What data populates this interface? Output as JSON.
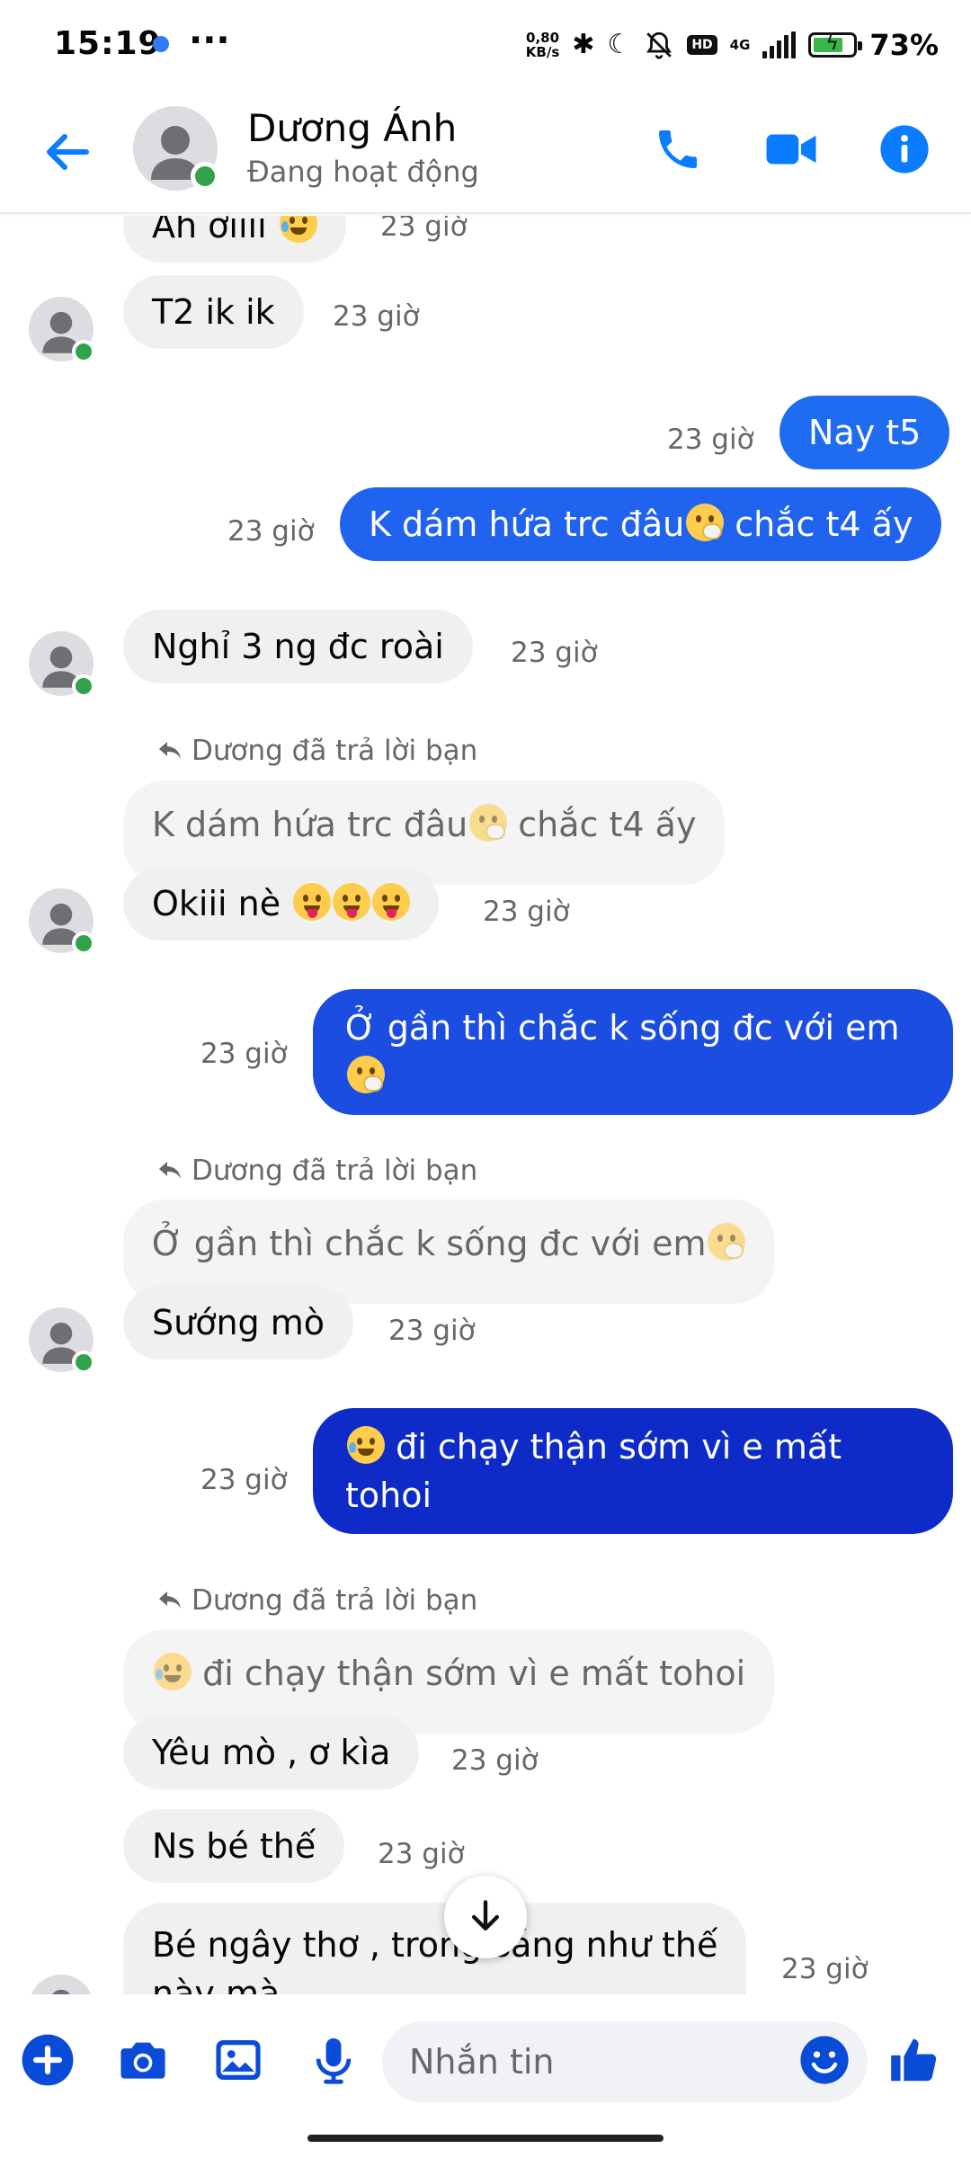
{
  "status_bar": {
    "time": "15:19",
    "speed": "0,80",
    "speed_unit": "KB/s",
    "hd": "HD",
    "network": "4G",
    "battery_pct": "73%"
  },
  "header": {
    "name": "Dương Ánh",
    "status": "Đang hoạt động",
    "icons": [
      "back-arrow-icon",
      "phone-icon",
      "video-icon",
      "info-icon"
    ]
  },
  "messages": {
    "m1": {
      "text": "Ah ơiiii",
      "time": "23 giờ"
    },
    "m2": {
      "text": "T2 ik ik",
      "time": "23 giờ"
    },
    "m3": {
      "text": "Nay t5",
      "time": "23 giờ"
    },
    "m4": {
      "text_a": "K dám hứa trc đâu",
      "text_b": " chắc t4 ấy",
      "time": "23 giờ"
    },
    "m5": {
      "text": "Nghỉ 3 ng đc roài",
      "time": "23 giờ"
    },
    "r1": {
      "label": "Dương đã trả lời bạn",
      "quote_a": "K dám hứa trc đâu",
      "quote_b": " chắc t4 ấy"
    },
    "m6": {
      "text": "Okiii nè",
      "time": "23 giờ"
    },
    "m7": {
      "text": "Ở gần thì chắc k sống đc với em",
      "time": "23 giờ"
    },
    "r2": {
      "label": "Dương đã trả lời bạn",
      "quote": "Ở gần thì chắc k sống đc với em"
    },
    "m8": {
      "text": "Sướng mò",
      "time": "23 giờ"
    },
    "m9": {
      "text": " đi chạy thận sớm vì e mất tohoi",
      "time": "23 giờ"
    },
    "r3": {
      "label": "Dương đã trả lời bạn",
      "quote": " đi chạy thận sớm vì e mất tohoi"
    },
    "m10": {
      "text": "Yêu mò , ơ kìa",
      "time": "23 giờ"
    },
    "m11": {
      "text": "Ns bé thế",
      "time": "23 giờ"
    },
    "m12": {
      "text": "Bé ngây thơ , trong sáng như thế",
      "text2": "này mà",
      "time": "23 giờ"
    }
  },
  "composer": {
    "placeholder": "Nhắn tin",
    "icons": [
      "plus-icon",
      "camera-icon",
      "image-icon",
      "mic-icon",
      "emoji-icon",
      "thumbs-up-icon"
    ]
  },
  "colors": {
    "accent": "#0a7cff",
    "out_light": "#1f6cf0",
    "out_mid": "#1a4de0",
    "out_dark": "#0e2bc8",
    "online": "#31a24c"
  }
}
